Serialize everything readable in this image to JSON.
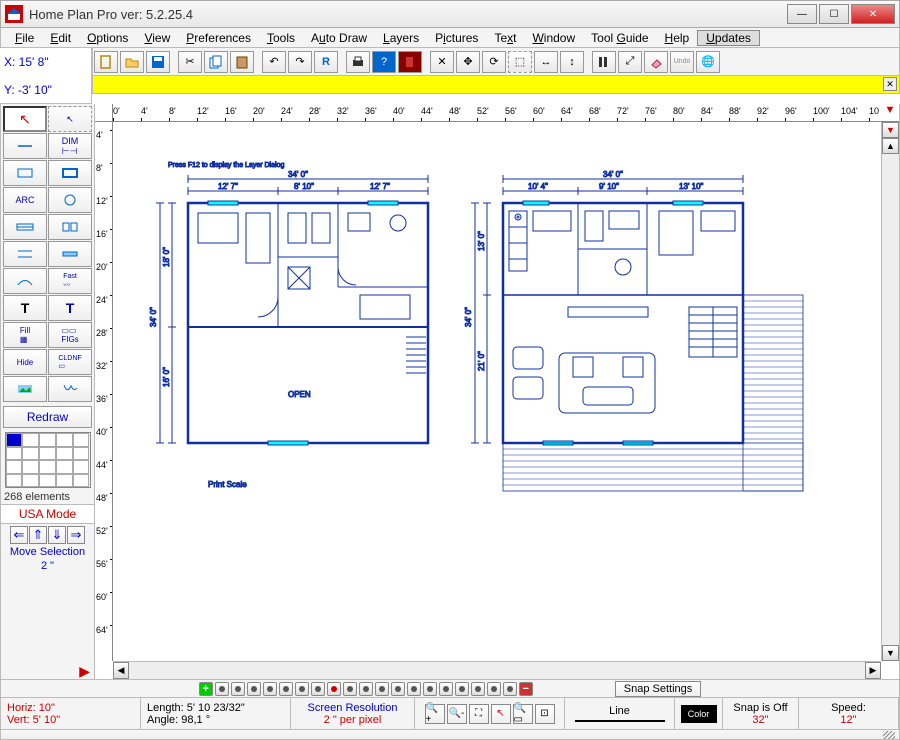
{
  "title": "Home Plan Pro ver: 5.2.25.4",
  "menu": [
    "File",
    "Edit",
    "Options",
    "View",
    "Preferences",
    "Tools",
    "Auto Draw",
    "Layers",
    "Pictures",
    "Text",
    "Window",
    "Tool Guide",
    "Help",
    "Updates"
  ],
  "coords": {
    "x": "X: 15' 8\"",
    "y": "Y: -3' 10\""
  },
  "ruler_h": [
    "0'",
    "4'",
    "8'",
    "12'",
    "16'",
    "20'",
    "24'",
    "28'",
    "32'",
    "36'",
    "40'",
    "44'",
    "48'",
    "52'",
    "56'",
    "60'",
    "64'",
    "68'",
    "72'",
    "76'",
    "80'",
    "84'",
    "88'",
    "92'",
    "96'",
    "100'",
    "104'",
    "10"
  ],
  "ruler_v": [
    "4'",
    "8'",
    "12'",
    "16'",
    "20'",
    "24'",
    "28'",
    "32'",
    "36'",
    "40'",
    "44'",
    "48'",
    "52'",
    "56'",
    "60'",
    "64'"
  ],
  "tools": {
    "redraw": "Redraw",
    "elcount": "268 elements",
    "usamode": "USA Mode",
    "movesel": "Move Selection",
    "movedim": "2 \""
  },
  "plan1": {
    "top_total": "34' 0\"",
    "top_a": "12' 7\"",
    "top_b": "8' 10\"",
    "top_c": "12' 7\"",
    "left_total": "34' 0\"",
    "left_a": "18' 0\"",
    "left_b": "16' 0\"",
    "open": "OPEN",
    "print": "Print Scale",
    "hint": "Press  F12  to display the Layer Dialog"
  },
  "plan2": {
    "top_total": "34' 0\"",
    "top_a": "10' 4\"",
    "top_b": "9' 10\"",
    "top_c": "13' 10\"",
    "left_total": "34' 0\"",
    "left_a": "13' 0\"",
    "left_b": "21' 0\""
  },
  "snapbtn": "Snap Settings",
  "status": {
    "horiz": "Horiz: 10\"",
    "vert": "Vert: 5' 10\"",
    "length": "Length: 5' 10 23/32\"",
    "angle": "Angle:  98,1 °",
    "res1": "Screen Resolution",
    "res2": "2 \" per pixel",
    "line": "Line",
    "color": "Color",
    "snap_l": "Snap is Off",
    "snap_v": "32\"",
    "speed_l": "Speed:",
    "speed_v": "12\""
  }
}
